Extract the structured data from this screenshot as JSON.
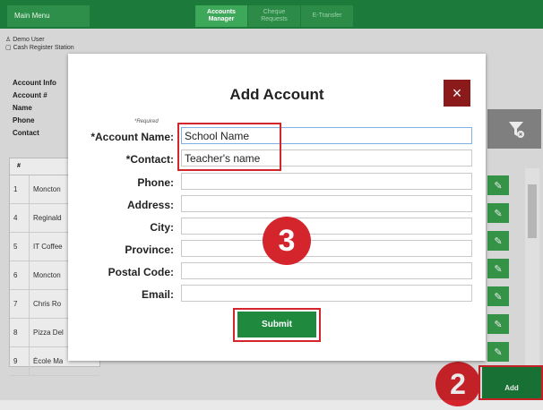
{
  "topbar": {
    "main_menu": "Main Menu",
    "tabs": [
      {
        "label_line1": "Accounts",
        "label_line2": "Manager",
        "active": true
      },
      {
        "label_line1": "Cheque",
        "label_line2": "Requests",
        "active": false
      },
      {
        "label_line1": "E-Transfer",
        "label_line2": "",
        "active": false
      }
    ]
  },
  "user": {
    "name": "Demo User",
    "station": "Cash Register Station"
  },
  "account_info": {
    "heading": "Account Info",
    "labels": [
      "Account #",
      "Name",
      "Phone",
      "Contact"
    ]
  },
  "grid": {
    "header": "#",
    "rows": [
      {
        "num": "1",
        "name": "Moncton"
      },
      {
        "num": "4",
        "name": "Reginald"
      },
      {
        "num": "5",
        "name": "IT Coffee"
      },
      {
        "num": "6",
        "name": "Moncton"
      },
      {
        "num": "7",
        "name": "Chris Ro"
      },
      {
        "num": "8",
        "name": "Pizza Del"
      },
      {
        "num": "9",
        "name": "École Ma"
      }
    ]
  },
  "add_button": "Add",
  "callouts": {
    "step2": "2",
    "step3": "3"
  },
  "modal": {
    "title": "Add Account",
    "close": "×",
    "required_note": "*Required",
    "fields": [
      {
        "label": "*Account Name:",
        "value": "School Name"
      },
      {
        "label": "*Contact:",
        "value": "Teacher's name"
      },
      {
        "label": "Phone:",
        "value": ""
      },
      {
        "label": "Address:",
        "value": ""
      },
      {
        "label": "City:",
        "value": ""
      },
      {
        "label": "Province:",
        "value": ""
      },
      {
        "label": "Postal Code:",
        "value": ""
      },
      {
        "label": "Email:",
        "value": ""
      }
    ],
    "submit": "Submit"
  },
  "colors": {
    "brand_green": "#1c7a3a",
    "highlight_red": "#d4242c",
    "close_red": "#8b1b1b"
  }
}
